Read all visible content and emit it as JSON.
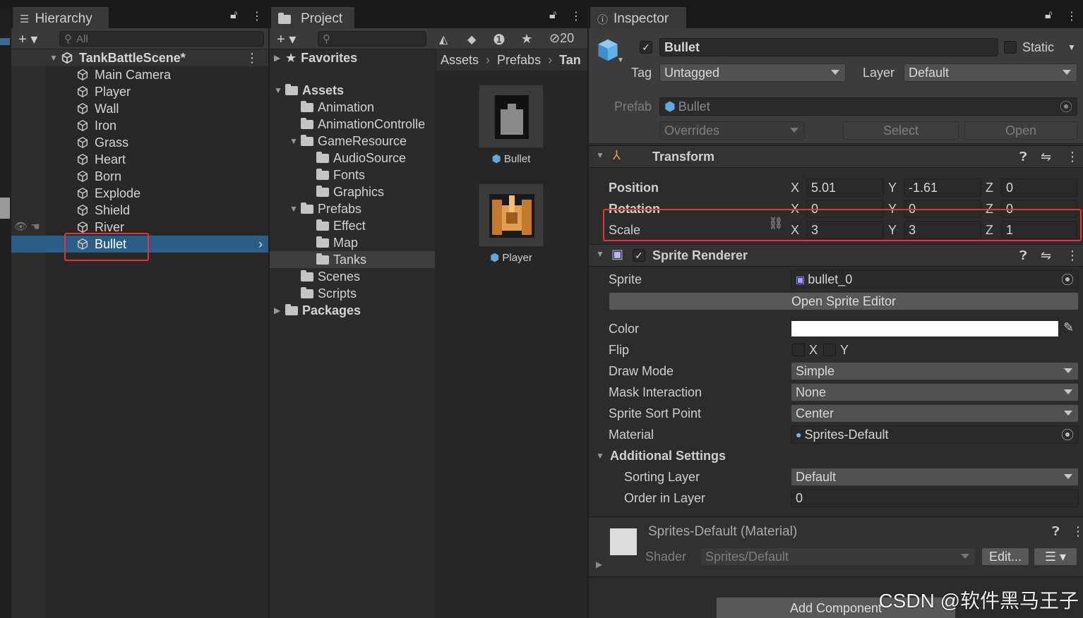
{
  "hierarchy": {
    "tab_label": "Hierarchy",
    "search_placeholder": "All",
    "scene_name": "TankBattleScene*",
    "items": [
      "Main Camera",
      "Player",
      "Wall",
      "Iron",
      "Grass",
      "Heart",
      "Born",
      "Explode",
      "Shield",
      "River",
      "Bullet"
    ],
    "selected": "Bullet"
  },
  "project": {
    "tab_label": "Project",
    "hidden_count": "20",
    "favorites": "Favorites",
    "assets": "Assets",
    "folders": [
      "Animation",
      "AnimationControlle",
      "GameResource",
      "AudioSource",
      "Fonts",
      "Graphics",
      "Prefabs",
      "Effect",
      "Map",
      "Tanks",
      "Scenes",
      "Scripts"
    ],
    "packages": "Packages",
    "breadcrumb": [
      "Assets",
      "Prefabs",
      "Tan"
    ],
    "assets_grid": [
      "Bullet",
      "Player"
    ]
  },
  "inspector": {
    "tab_label": "Inspector",
    "object_name": "Bullet",
    "static_label": "Static",
    "tag_label": "Tag",
    "tag_value": "Untagged",
    "layer_label": "Layer",
    "layer_value": "Default",
    "prefab_label": "Prefab",
    "prefab_value": "Bullet",
    "overrides_label": "Overrides",
    "select_label": "Select",
    "open_label": "Open",
    "transform": {
      "title": "Transform",
      "position_label": "Position",
      "rotation_label": "Rotation",
      "scale_label": "Scale",
      "x": "X",
      "y": "Y",
      "z": "Z",
      "position": [
        "5.01",
        "-1.61",
        "0"
      ],
      "rotation": [
        "0",
        "0",
        "0"
      ],
      "scale": [
        "3",
        "3",
        "1"
      ]
    },
    "sprite_renderer": {
      "title": "Sprite Renderer",
      "sprite_label": "Sprite",
      "sprite_value": "bullet_0",
      "open_editor": "Open Sprite Editor",
      "color_label": "Color",
      "color_value": "#ffffff",
      "flip_label": "Flip",
      "flip_x": "X",
      "flip_y": "Y",
      "draw_mode_label": "Draw Mode",
      "draw_mode_value": "Simple",
      "mask_label": "Mask Interaction",
      "mask_value": "None",
      "sort_point_label": "Sprite Sort Point",
      "sort_point_value": "Center",
      "material_label": "Material",
      "material_value": "Sprites-Default",
      "additional_label": "Additional Settings",
      "sorting_layer_label": "Sorting Layer",
      "sorting_layer_value": "Default",
      "order_label": "Order in Layer",
      "order_value": "0"
    },
    "material_section": {
      "title": "Sprites-Default (Material)",
      "shader_label": "Shader",
      "shader_value": "Sprites/Default",
      "edit_label": "Edit..."
    },
    "add_component": "Add Component"
  },
  "watermark": "CSDN @软件黑马王子",
  "colors": {
    "selection": "#2c5d87",
    "highlight_box": "#e53535"
  }
}
